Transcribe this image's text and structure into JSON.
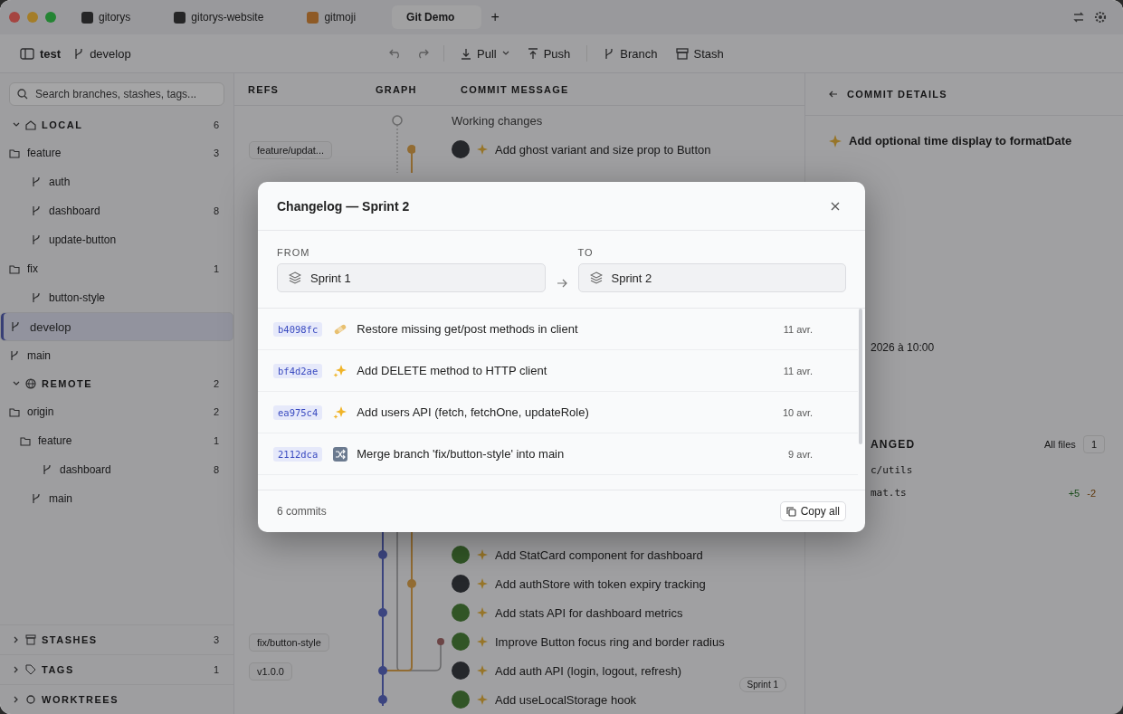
{
  "tabs": [
    {
      "label": "gitorys",
      "selected": false
    },
    {
      "label": "gitorys-website",
      "selected": false
    },
    {
      "label": "gitmoji",
      "selected": false
    },
    {
      "label": "Git Demo",
      "selected": true
    }
  ],
  "new_tab": "+",
  "toolbar": {
    "repo": "test",
    "branch": "develop",
    "actions": [
      {
        "label": "Pull",
        "menu": true
      },
      {
        "label": "Push",
        "menu": false
      },
      {
        "label": "Branch",
        "menu": false
      },
      {
        "label": "Stash",
        "menu": false
      }
    ]
  },
  "sidebar": {
    "search": {
      "placeholder": "Search branches, stashes, tags..."
    },
    "sections": [
      {
        "title": "LOCAL",
        "count": "6",
        "expanded": true,
        "children": [
          {
            "label": "feature",
            "kind": "folder",
            "count": "3",
            "selected": false,
            "children": [
              {
                "label": "auth",
                "kind": "branch",
                "selected": false
              },
              {
                "label": "dashboard",
                "kind": "branch",
                "count": "8",
                "selected": false
              },
              {
                "label": "update-button",
                "kind": "branch",
                "selected": false
              }
            ]
          },
          {
            "label": "fix",
            "kind": "folder",
            "count": "1",
            "selected": false,
            "children": [
              {
                "label": "button-style",
                "kind": "branch",
                "selected": false
              }
            ]
          },
          {
            "label": "develop",
            "kind": "branch",
            "selected": true
          },
          {
            "label": "main",
            "kind": "branch",
            "selected": false
          }
        ]
      },
      {
        "title": "REMOTE",
        "count": "2",
        "expanded": true,
        "children": [
          {
            "label": "origin",
            "kind": "folder",
            "count": "2",
            "selected": false,
            "children": [
              {
                "label": "feature",
                "kind": "folder",
                "count": "1",
                "selected": false,
                "children": [
                  {
                    "label": "dashboard",
                    "kind": "branch",
                    "count": "8",
                    "selected": false
                  }
                ]
              },
              {
                "label": "main",
                "kind": "branch",
                "selected": false
              }
            ]
          }
        ]
      }
    ],
    "footer_sections": [
      {
        "title": "STASHES",
        "count": "3",
        "expanded": false
      },
      {
        "title": "TAGS",
        "count": "1",
        "expanded": false
      },
      {
        "title": "WORKTREES",
        "expanded": false
      }
    ]
  },
  "history": {
    "columns": [
      "REFS",
      "GRAPH",
      "COMMIT MESSAGE"
    ],
    "rows_top": [
      {
        "message": "Working changes",
        "kind": "working"
      },
      {
        "message": "Add ghost variant and size prop to Button",
        "kind": "commit",
        "ref": "feature/updat..."
      }
    ],
    "rows_bottom": [
      {
        "message": "Add StatCard component for dashboard",
        "kind": "commit"
      },
      {
        "message": "Add authStore with token expiry tracking",
        "kind": "commit"
      },
      {
        "message": "Add stats API for dashboard metrics",
        "kind": "commit"
      },
      {
        "message": "Improve Button focus ring and border radius",
        "kind": "commit",
        "ref": "fix/button-style"
      },
      {
        "message": "Add auth API (login, logout, refresh)",
        "kind": "commit",
        "ref": "v1.0.0",
        "tag_right": "Sprint 1"
      },
      {
        "message": "Add useLocalStorage hook",
        "kind": "commit"
      }
    ]
  },
  "details": {
    "header": "COMMIT DETAILS",
    "title": "Add optional time display to formatDate",
    "date_fragment": "2026 à 10:00",
    "files_heading_fragment": "ANGED",
    "filter": "All files",
    "files_count": "1",
    "folder_fragment": "c/utils",
    "file_fragment": "mat.ts",
    "additions": "+5",
    "deletions": "-2"
  },
  "modal": {
    "title": "Changelog — Sprint 2",
    "from_label": "FROM",
    "from": "Sprint 1",
    "to_label": "TO",
    "to": "Sprint 2",
    "commits": [
      {
        "hash": "b4098fc",
        "kind": "bandage",
        "message": "Restore missing get/post methods in client",
        "date": "11 avr."
      },
      {
        "hash": "bf4d2ae",
        "kind": "sparkles",
        "message": "Add DELETE method to HTTP client",
        "date": "11 avr."
      },
      {
        "hash": "ea975c4",
        "kind": "sparkles",
        "message": "Add users API (fetch, fetchOne, updateRole)",
        "date": "10 avr."
      },
      {
        "hash": "2112dca",
        "kind": "shuffle",
        "message": "Merge branch 'fix/button-style' into main",
        "date": "9 avr."
      }
    ],
    "count": "6 commits",
    "copy": "Copy all"
  }
}
